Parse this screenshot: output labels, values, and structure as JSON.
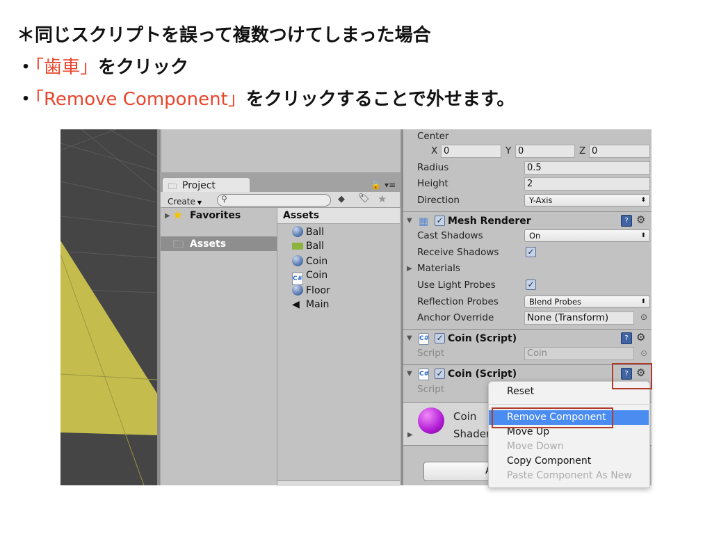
{
  "slide": {
    "heading": "＊同じスクリプトを誤って複数つけてしまった場合",
    "bullets": [
      {
        "bullet": "・",
        "highlight": "「歯車」",
        "text": "をクリック"
      },
      {
        "bullet": "・",
        "highlight": "「Remove Component」",
        "text": "をクリックすることで外せます。"
      }
    ],
    "highlight_color": "#e8452c"
  },
  "project": {
    "tab_label": "Project",
    "create_label": "Create",
    "search_placeholder": "",
    "favorites_label": "Favorites",
    "assets_folder_label": "Assets",
    "assets_header": "Assets",
    "assets": [
      {
        "name": "Ball",
        "icon": "material-sphere-icon"
      },
      {
        "name": "Ball",
        "icon": "prefab-icon"
      },
      {
        "name": "Coin",
        "icon": "material-sphere-icon"
      },
      {
        "name": "Coin",
        "icon": "csharp-script-icon"
      },
      {
        "name": "Floor",
        "icon": "material-sphere-icon"
      },
      {
        "name": "Main",
        "icon": "unity-scene-icon"
      }
    ]
  },
  "inspector": {
    "collider": {
      "center_label": "Center",
      "x_label": "X",
      "x": "0",
      "y_label": "Y",
      "y": "0",
      "z_label": "Z",
      "z": "0",
      "radius_label": "Radius",
      "radius": "0.5",
      "height_label": "Height",
      "height": "2",
      "direction_label": "Direction",
      "direction": "Y-Axis"
    },
    "mesh_renderer": {
      "title": "Mesh Renderer",
      "cast_shadows_label": "Cast Shadows",
      "cast_shadows": "On",
      "receive_shadows_label": "Receive Shadows",
      "receive_shadows": true,
      "materials_label": "Materials",
      "use_light_probes_label": "Use Light Probes",
      "use_light_probes": true,
      "reflection_probes_label": "Reflection Probes",
      "reflection_probes": "Blend Probes",
      "anchor_override_label": "Anchor Override",
      "anchor_override": "None (Transform)"
    },
    "script1": {
      "title": "Coin (Script)",
      "script_label": "Script",
      "script_value": "Coin"
    },
    "script2": {
      "title": "Coin (Script)",
      "script_label": "Script"
    },
    "material": {
      "name": "Coin",
      "shader_label": "Shader"
    },
    "add_button_partial": "A"
  },
  "context_menu": {
    "items": [
      {
        "label": "Reset",
        "enabled": true
      },
      {
        "label": "Remove Component",
        "enabled": true,
        "highlighted": true
      },
      {
        "label": "Move Up",
        "enabled": true
      },
      {
        "label": "Move Down",
        "enabled": false
      },
      {
        "label": "Copy Component",
        "enabled": true
      },
      {
        "label": "Paste Component As New",
        "enabled": false
      }
    ],
    "highlight_color": "#4a8cf0",
    "annotation_color": "#b33a2a"
  }
}
